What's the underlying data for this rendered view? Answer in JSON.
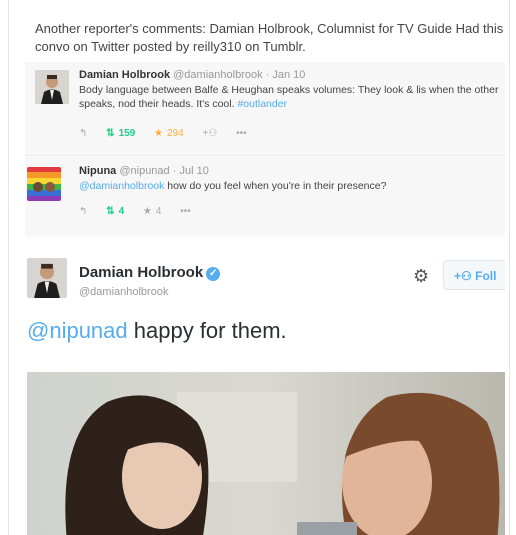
{
  "post": {
    "caption": "Another reporter's comments: Damian Holbrook, Columnist for TV Guide Had this convo on Twitter posted by reilly310 on Tumblr."
  },
  "tweet1": {
    "name": "Damian Holbrook",
    "handle": "@damianholbrook",
    "date": "· Jan 10",
    "text": "Body language between Balfe & Heughan speaks volumes: They look & lis when the other speaks, nod their heads. It's cool.",
    "hashtag": "#outlander",
    "retweets": "159",
    "favorites": "294",
    "more": "•••"
  },
  "tweet2": {
    "name": "Nipuna",
    "handle": "@nipunad",
    "date": "· Jul 10",
    "mention": "@damianholbrook",
    "text": "how do you feel when you're in their presence?",
    "retweets": "4",
    "favorites": "4",
    "more": "•••"
  },
  "tweet3": {
    "name": "Damian Holbrook",
    "handle": "@damianholbrook",
    "mention": "@nipunad",
    "text": "happy for them.",
    "follow_label": "Foll"
  },
  "icons": {
    "reply": "reply-icon",
    "retweet": "retweet-icon",
    "favorite": "star-icon",
    "gear": "gear-icon",
    "verified": "verified-icon",
    "follow": "add-user-icon"
  },
  "colors": {
    "link": "#55acee",
    "retweet": "#19cf86",
    "favorite": "#ffac33"
  }
}
